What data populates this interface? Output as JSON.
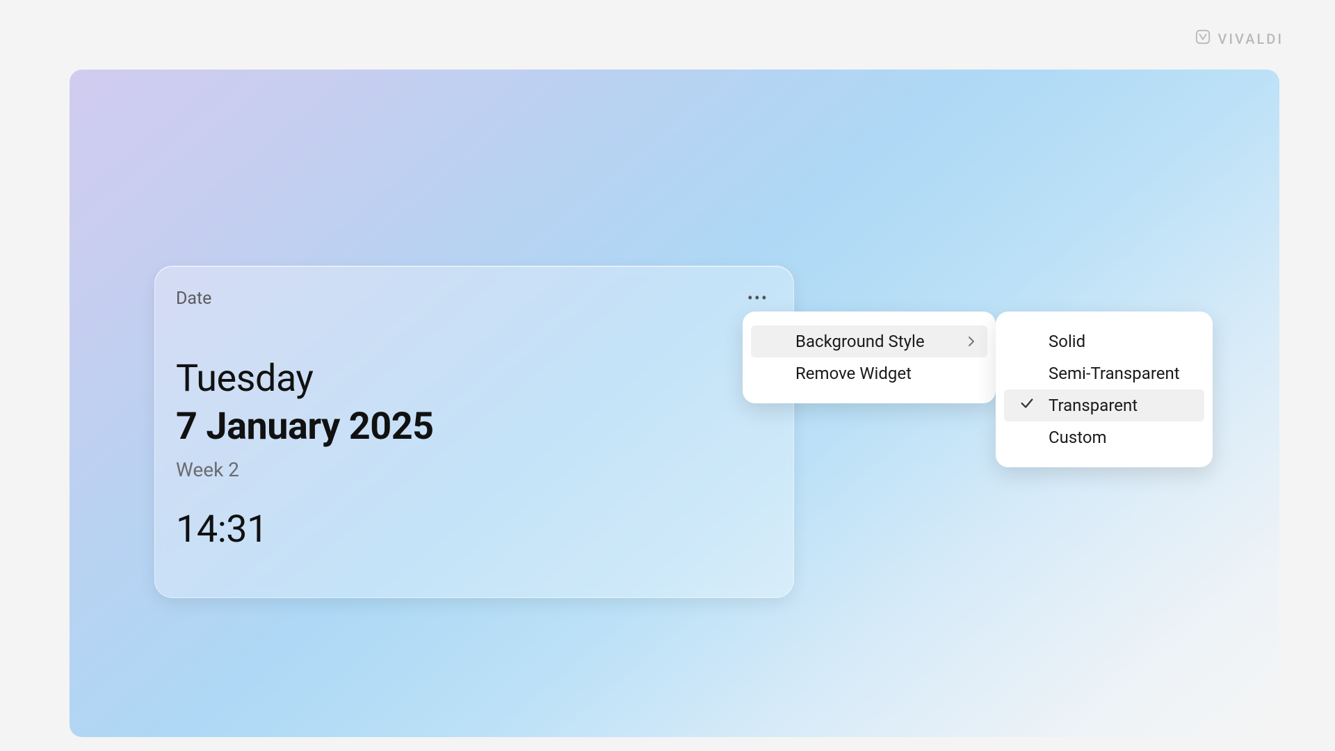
{
  "brand": {
    "name": "VIVALDI"
  },
  "widget": {
    "title": "Date",
    "day_of_week": "Tuesday",
    "full_date": "7 January 2025",
    "week_label": "Week 2",
    "time": "14:31"
  },
  "context_menu": {
    "items": [
      {
        "label": "Background Style",
        "has_submenu": true,
        "hovered": true
      },
      {
        "label": "Remove Widget",
        "has_submenu": false,
        "hovered": false
      }
    ]
  },
  "submenu": {
    "items": [
      {
        "label": "Solid",
        "checked": false,
        "hovered": false
      },
      {
        "label": "Semi-Transparent",
        "checked": false,
        "hovered": false
      },
      {
        "label": "Transparent",
        "checked": true,
        "hovered": true
      },
      {
        "label": "Custom",
        "checked": false,
        "hovered": false
      }
    ]
  }
}
